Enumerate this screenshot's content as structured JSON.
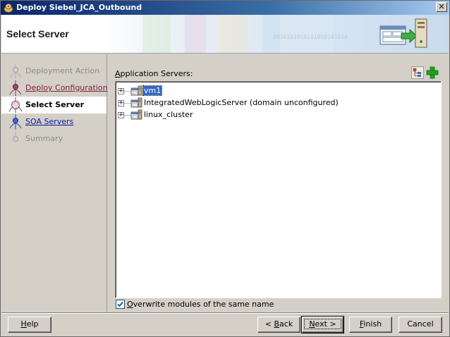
{
  "window": {
    "title": "Deploy Siebel_JCA_Outbound",
    "close_glyph": "✕"
  },
  "header": {
    "title": "Select Server",
    "banner_text": "0010101010101010101010"
  },
  "steps": [
    {
      "label": "Deployment Action",
      "state": "disabled"
    },
    {
      "label": "Deploy Configuration",
      "state": "visited"
    },
    {
      "label": "Select Server",
      "state": "current"
    },
    {
      "label": "SOA Servers",
      "state": "link"
    },
    {
      "label": "Summary",
      "state": "disabled"
    }
  ],
  "content": {
    "servers_label_mnemonic": "A",
    "servers_label_rest": "pplication Servers:",
    "tree": [
      {
        "label": "vm1",
        "selected": true,
        "expander": "+"
      },
      {
        "label": "IntegratedWebLogicServer (domain unconfigured)",
        "selected": false,
        "expander": "+"
      },
      {
        "label": "linux_cluster",
        "selected": false,
        "expander": "+"
      }
    ],
    "overwrite": {
      "checked": true,
      "label_pre": "",
      "label_mnemonic": "O",
      "label_rest": "verwrite modules of the same name"
    }
  },
  "buttons": {
    "help": {
      "mn": "H",
      "rest": "elp"
    },
    "back": {
      "pre": "< ",
      "mn": "B",
      "rest": "ack"
    },
    "next": {
      "mn": "N",
      "rest": "ext >"
    },
    "finish": {
      "mn": "F",
      "rest": "inish"
    },
    "cancel": "Cancel"
  },
  "colors": {
    "title_gradient_start": "#0a246a",
    "selection": "#316ac5",
    "visited_link": "#7a1f3a",
    "link": "#0a1a9a",
    "add_icon": "#1fa31f"
  },
  "icons": {
    "app": "oracle-jdeveloper-icon",
    "close": "close-icon",
    "header_graphic": "deploy-to-server-icon",
    "tool1": "server-tree-icon",
    "tool2": "add-icon",
    "server": "application-server-icon"
  }
}
